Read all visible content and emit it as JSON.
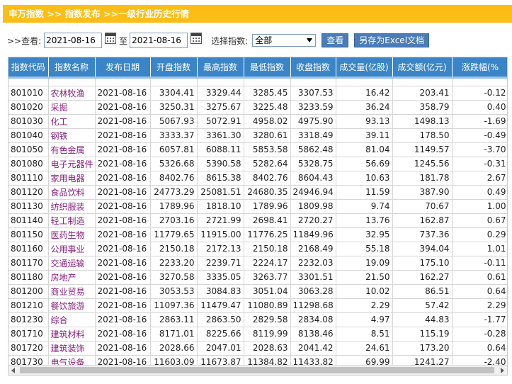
{
  "breadcrumb": "申万指数 >> 指数发布 >>一级行业历史行情",
  "controls": {
    "view_label": ">>查看:",
    "date_from": "2021-08-16",
    "to_label": "至",
    "date_to": "2021-08-16",
    "select_label": "选择指数:",
    "select_value": "全部",
    "view_button": "查看",
    "export_button": "另存为Excel文档"
  },
  "table": {
    "columns": [
      "指数代码",
      "指数名称",
      "发布日期",
      "开盘指数",
      "最高指数",
      "最低指数",
      "收盘指数",
      "成交量(亿股)",
      "成交额(亿元)",
      "涨跌幅(%"
    ],
    "rows": [
      [
        "801010",
        "农林牧渔",
        "2021-08-16",
        "3304.41",
        "3329.44",
        "3285.45",
        "3307.53",
        "16.42",
        "203.41",
        "-0.12"
      ],
      [
        "801020",
        "采掘",
        "2021-08-16",
        "3250.31",
        "3275.67",
        "3225.48",
        "3233.59",
        "36.24",
        "358.79",
        "0.40"
      ],
      [
        "801030",
        "化工",
        "2021-08-16",
        "5067.93",
        "5072.91",
        "4958.02",
        "4975.90",
        "93.13",
        "1498.13",
        "-1.69"
      ],
      [
        "801040",
        "钢铁",
        "2021-08-16",
        "3333.37",
        "3361.30",
        "3280.61",
        "3318.49",
        "39.11",
        "178.50",
        "-0.49"
      ],
      [
        "801050",
        "有色金属",
        "2021-08-16",
        "6057.81",
        "6088.11",
        "5853.58",
        "5862.48",
        "81.04",
        "1149.57",
        "-3.70"
      ],
      [
        "801080",
        "电子元器件",
        "2021-08-16",
        "5326.68",
        "5390.58",
        "5282.64",
        "5328.75",
        "56.69",
        "1245.56",
        "-0.31"
      ],
      [
        "801110",
        "家用电器",
        "2021-08-16",
        "8402.76",
        "8615.38",
        "8402.76",
        "8604.43",
        "10.63",
        "181.78",
        "2.67"
      ],
      [
        "801120",
        "食品饮料",
        "2021-08-16",
        "24773.29",
        "25081.51",
        "24680.35",
        "24946.94",
        "11.59",
        "387.90",
        "0.49"
      ],
      [
        "801130",
        "纺织服装",
        "2021-08-16",
        "1789.96",
        "1818.10",
        "1789.96",
        "1809.98",
        "9.74",
        "70.67",
        "1.00"
      ],
      [
        "801140",
        "轻工制造",
        "2021-08-16",
        "2703.16",
        "2721.99",
        "2698.41",
        "2720.27",
        "13.76",
        "162.87",
        "0.67"
      ],
      [
        "801150",
        "医药生物",
        "2021-08-16",
        "11779.65",
        "11915.00",
        "11776.25",
        "11849.96",
        "32.95",
        "737.36",
        "0.29"
      ],
      [
        "801160",
        "公用事业",
        "2021-08-16",
        "2150.18",
        "2172.13",
        "2150.18",
        "2168.49",
        "55.18",
        "394.04",
        "1.01"
      ],
      [
        "801170",
        "交通运输",
        "2021-08-16",
        "2233.20",
        "2239.71",
        "2224.17",
        "2232.03",
        "19.09",
        "175.10",
        "-0.11"
      ],
      [
        "801180",
        "房地产",
        "2021-08-16",
        "3270.58",
        "3335.05",
        "3263.77",
        "3301.51",
        "21.50",
        "162.27",
        "0.61"
      ],
      [
        "801200",
        "商业贸易",
        "2021-08-16",
        "3053.53",
        "3084.83",
        "3051.04",
        "3063.28",
        "10.02",
        "86.51",
        "0.64"
      ],
      [
        "801210",
        "餐饮旅游",
        "2021-08-16",
        "11097.36",
        "11479.47",
        "11080.89",
        "11298.68",
        "2.29",
        "57.42",
        "2.29"
      ],
      [
        "801230",
        "综合",
        "2021-08-16",
        "2863.11",
        "2863.50",
        "2829.58",
        "2834.08",
        "4.97",
        "44.83",
        "-1.77"
      ],
      [
        "801710",
        "建筑材料",
        "2021-08-16",
        "8171.01",
        "8225.66",
        "8119.99",
        "8138.46",
        "8.51",
        "115.19",
        "-0.28"
      ],
      [
        "801720",
        "建筑装饰",
        "2021-08-16",
        "2028.66",
        "2047.01",
        "2028.63",
        "2041.42",
        "24.61",
        "173.20",
        "0.64"
      ],
      [
        "801730",
        "电气设备",
        "2021-08-16",
        "11603.09",
        "11673.87",
        "11384.82",
        "11433.82",
        "69.99",
        "1241.27",
        "-2.40"
      ]
    ]
  }
}
